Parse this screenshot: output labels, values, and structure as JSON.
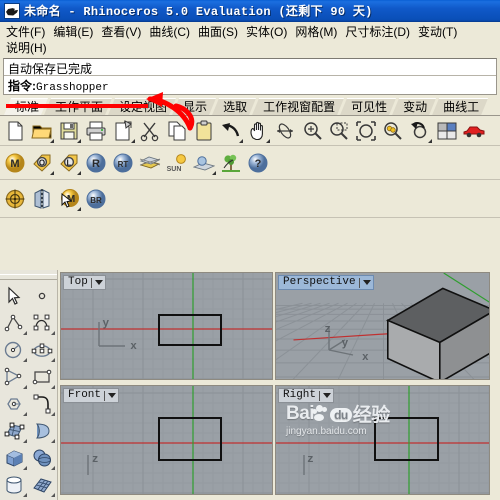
{
  "window": {
    "title": "未命名 - Rhinoceros 5.0 Evaluation (还剩下 90 天)",
    "icon": "rhino-icon"
  },
  "menu": {
    "row1": [
      {
        "label": "文件(F)"
      },
      {
        "label": "编辑(E)"
      },
      {
        "label": "查看(V)"
      },
      {
        "label": "曲线(C)"
      },
      {
        "label": "曲面(S)"
      },
      {
        "label": "实体(O)"
      },
      {
        "label": "网格(M)"
      },
      {
        "label": "尺寸标注(D)"
      },
      {
        "label": "变动(T)"
      }
    ],
    "row2": [
      {
        "label": "说明(H)"
      }
    ]
  },
  "command": {
    "history": "自动保存已完成",
    "prompt_label": "指令:",
    "prompt_value": "Grasshopper"
  },
  "tabs": [
    {
      "label": "标准",
      "active": true
    },
    {
      "label": "工作平面",
      "active": false
    },
    {
      "label": "设定视图",
      "active": false
    },
    {
      "label": "显示",
      "active": false
    },
    {
      "label": "选取",
      "active": false
    },
    {
      "label": "工作视窗配置",
      "active": false
    },
    {
      "label": "可见性",
      "active": false
    },
    {
      "label": "变动",
      "active": false
    },
    {
      "label": "曲线工",
      "active": false
    }
  ],
  "toolbar_row1": [
    {
      "name": "new-file-icon",
      "glyph": "page"
    },
    {
      "name": "open-file-icon",
      "glyph": "folder"
    },
    {
      "name": "save-file-icon",
      "glyph": "floppy"
    },
    {
      "name": "print-icon",
      "glyph": "printer"
    },
    {
      "name": "properties-icon",
      "glyph": "pageprops"
    },
    {
      "name": "cut-icon",
      "glyph": "scissors"
    },
    {
      "name": "copy-icon",
      "glyph": "copy"
    },
    {
      "name": "paste-icon",
      "glyph": "clipboard"
    },
    {
      "name": "undo-icon",
      "glyph": "undo"
    },
    {
      "name": "pan-icon",
      "glyph": "hand"
    },
    {
      "name": "rotate-view-icon",
      "glyph": "rotate"
    },
    {
      "name": "zoom-in-icon",
      "glyph": "zoomplus"
    },
    {
      "name": "zoom-window-icon",
      "glyph": "zoomwin"
    },
    {
      "name": "zoom-extents-icon",
      "glyph": "zoomext"
    },
    {
      "name": "zoom-selected-icon",
      "glyph": "zoomsel"
    },
    {
      "name": "zoom-previous-icon",
      "glyph": "zoomprev"
    },
    {
      "name": "four-view-icon",
      "glyph": "fourview"
    },
    {
      "name": "car-icon",
      "glyph": "car"
    }
  ],
  "toolbar_row2": [
    {
      "name": "material-icon",
      "glyph": "ballM",
      "letter": "M"
    },
    {
      "name": "object-properties-icon",
      "glyph": "tagO",
      "letter": "O"
    },
    {
      "name": "layer-icon",
      "glyph": "tagL",
      "letter": "L"
    },
    {
      "name": "render-icon",
      "glyph": "ballR",
      "letter": "R"
    },
    {
      "name": "render-preview-icon",
      "glyph": "ballRT",
      "letter": "RT"
    },
    {
      "name": "ground-plane-icon",
      "glyph": "planes"
    },
    {
      "name": "sun-icon",
      "glyph": "sun",
      "letter": "SUN"
    },
    {
      "name": "environment-icon",
      "glyph": "env"
    },
    {
      "name": "plant-icon",
      "glyph": "plant"
    },
    {
      "name": "help-icon",
      "glyph": "ballQ",
      "letter": "?"
    }
  ],
  "toolbar_row3": [
    {
      "name": "target-icon",
      "glyph": "target"
    },
    {
      "name": "mirror-icon",
      "glyph": "mirror"
    },
    {
      "name": "material-editor-icon",
      "glyph": "ballMcursor",
      "letter": "M"
    },
    {
      "name": "bongo-render-icon",
      "glyph": "ballBR",
      "letter": "BR"
    }
  ],
  "side_palette": [
    {
      "name": "select-arrow-icon",
      "glyph": "arrow"
    },
    {
      "name": "point-icon",
      "glyph": "point"
    },
    {
      "name": "polyline-icon",
      "glyph": "polyline"
    },
    {
      "name": "curve-icon",
      "glyph": "curve"
    },
    {
      "name": "circle-icon",
      "glyph": "circle"
    },
    {
      "name": "ellipse-icon",
      "glyph": "ellipse"
    },
    {
      "name": "arc-icon",
      "glyph": "arc"
    },
    {
      "name": "rectangle-icon",
      "glyph": "rectangle"
    },
    {
      "name": "polygon-icon",
      "glyph": "polygon"
    },
    {
      "name": "curve-corner-icon",
      "glyph": "fillet"
    },
    {
      "name": "surface-from-curves-icon",
      "glyph": "surfptgrid"
    },
    {
      "name": "loft-surface-icon",
      "glyph": "loft"
    },
    {
      "name": "box-icon",
      "glyph": "box"
    },
    {
      "name": "sphere-icon",
      "glyph": "spheres"
    },
    {
      "name": "cylinder-icon",
      "glyph": "cylinder"
    },
    {
      "name": "mesh-icon",
      "glyph": "mesh"
    }
  ],
  "viewports": [
    {
      "name": "viewport-top",
      "label": "Top",
      "active": false,
      "axes": [
        "y",
        "x"
      ],
      "has_object": true,
      "object": "rectangle"
    },
    {
      "name": "viewport-perspective",
      "label": "Perspective",
      "active": true,
      "axes": [
        "z",
        "y",
        "x"
      ],
      "has_object": true,
      "object": "shaded-box"
    },
    {
      "name": "viewport-front",
      "label": "Front",
      "active": false,
      "axes": [
        "z"
      ],
      "has_object": true,
      "object": "rectangle"
    },
    {
      "name": "viewport-right",
      "label": "Right",
      "active": false,
      "axes": [
        "z"
      ],
      "has_object": true,
      "object": "rectangle"
    }
  ],
  "watermark": {
    "brand": "Bai",
    "badge": "du",
    "suffix": "经验",
    "url": "jingyan.baidu.com"
  },
  "colors": {
    "titlebar": "#0a5fd4",
    "chrome": "#ece9d8",
    "viewport_bg": "#9aa0a6",
    "grid_line": "#8b9197",
    "axis_x": "#c03030",
    "axis_y": "#2f9e2f",
    "active_vp_title": "#9cb8d8",
    "annotation": "#ff0000",
    "object_outline": "#101010"
  }
}
